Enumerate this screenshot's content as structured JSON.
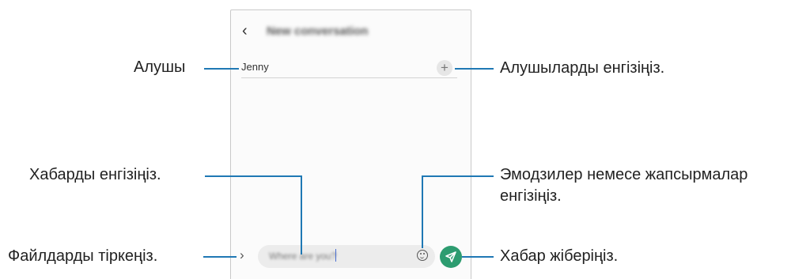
{
  "screen": {
    "back_icon": "chevron-left-icon",
    "title": "New conversation",
    "recipient_value": "Jenny",
    "add_icon": "plus-icon",
    "attach_icon": "chevron-right-icon",
    "message_placeholder": "Where are you?",
    "emoji_icon": "smiley-icon",
    "send_icon": "paper-plane-icon",
    "send_color": "#2d9c70"
  },
  "callouts": {
    "recipient": "Алушы",
    "enter_recipients": "Алушыларды енгізіңіз.",
    "enter_message": "Хабарды енгізіңіз.",
    "emoji_line1": "Эмодзилер немесе жапсырмалар",
    "emoji_line2": "енгізіңіз.",
    "attach_files": "Файлдарды тіркеңіз.",
    "send_message": "Хабар жіберіңіз."
  },
  "accent_color": "#1f78b4"
}
